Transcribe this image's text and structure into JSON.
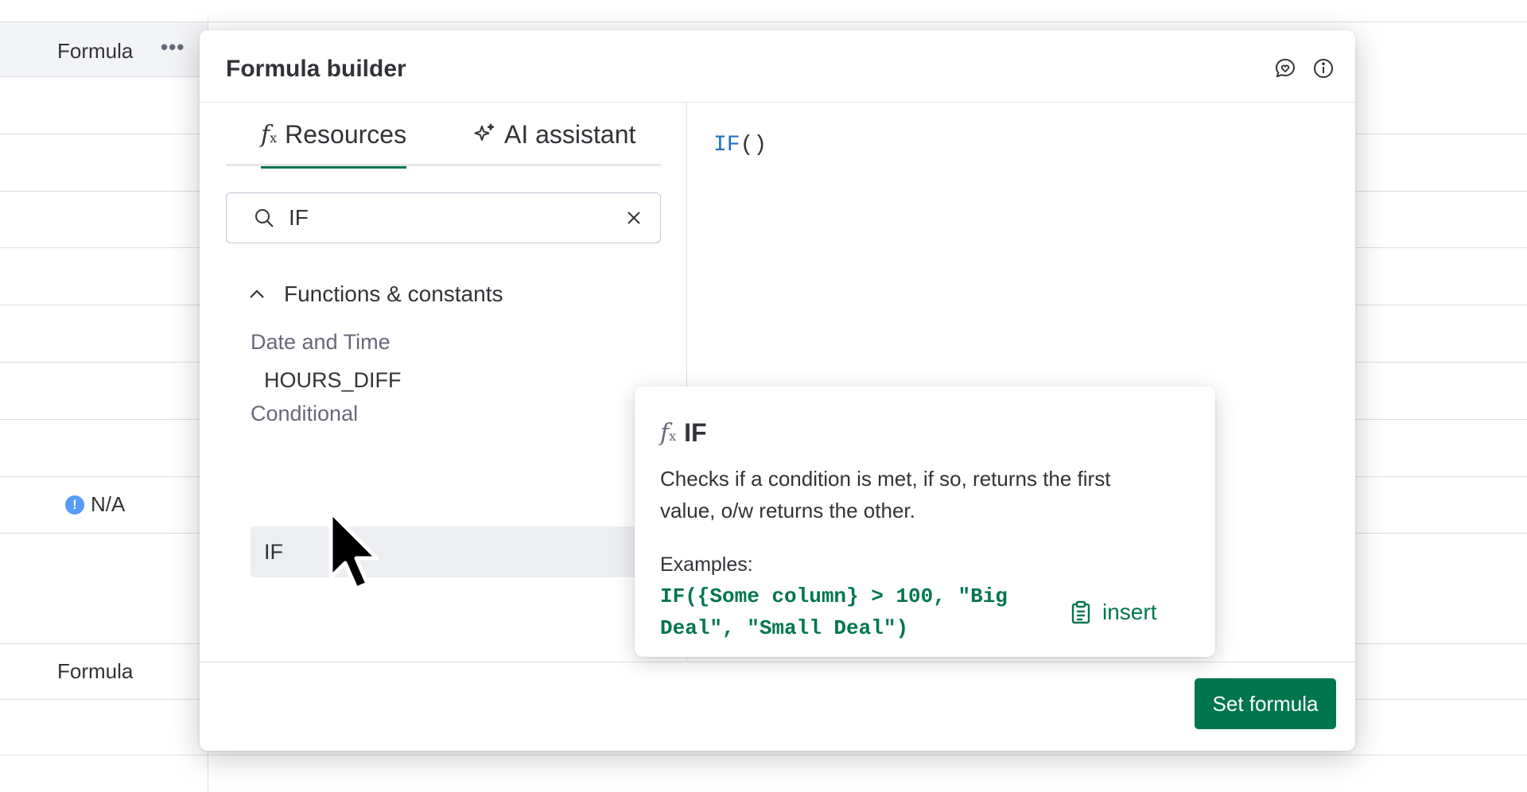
{
  "board": {
    "column_title": "Formula",
    "na_value": "N/A",
    "warning_icon": "!",
    "column_title_lower": "Formula",
    "more_icon": "•••"
  },
  "modal": {
    "title": "Formula builder",
    "icons": [
      "feedback-icon",
      "info-icon"
    ]
  },
  "tabs": [
    {
      "label": "Resources",
      "icon": "function-icon",
      "active": true
    },
    {
      "label": "AI assistant",
      "icon": "sparkle-icon",
      "active": false
    }
  ],
  "search": {
    "value": "IF",
    "placeholder": ""
  },
  "sections": {
    "functions_label": "Functions & constants",
    "groups": [
      {
        "label": "Date and Time",
        "items": [
          "HOURS_DIFF"
        ]
      },
      {
        "label": "Conditional",
        "items": [
          "IF"
        ]
      }
    ]
  },
  "editor": {
    "keyword": "IF",
    "rest": "()"
  },
  "tooltip": {
    "name": "IF",
    "description": "Checks if a condition is met, if so, returns the first value, o/w returns the other.",
    "examples_label": "Examples:",
    "example_code": "IF({Some column} > 100, \"Big Deal\", \"Small Deal\")",
    "insert_label": "insert"
  },
  "footer": {
    "set_formula_label": "Set formula"
  },
  "colors": {
    "primary": "#00764f",
    "keyword_blue": "#1f6fbf",
    "warning_blue": "#579bfc"
  }
}
